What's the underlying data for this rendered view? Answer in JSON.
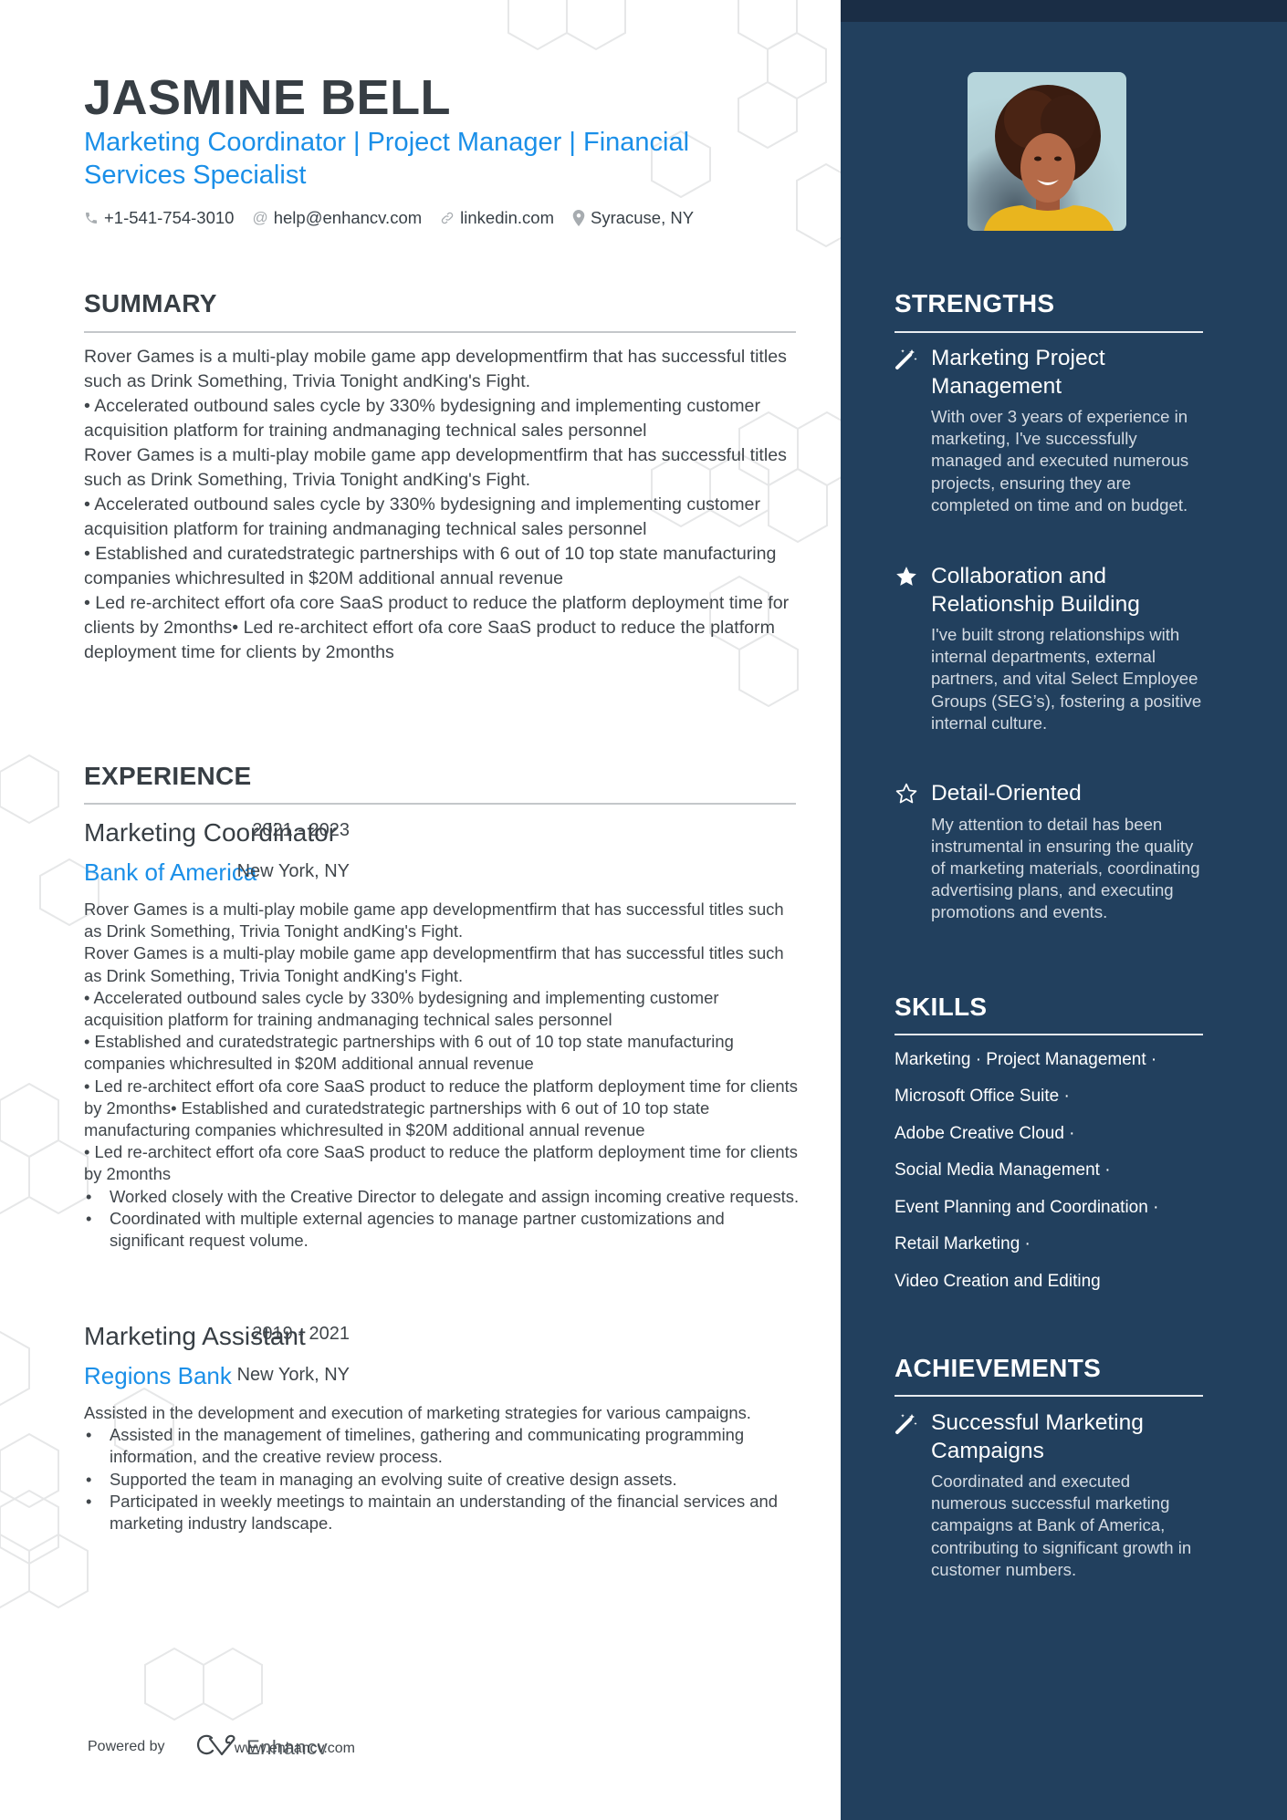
{
  "header": {
    "name": "JASMINE BELL",
    "subtitle": "Marketing Coordinator | Project Manager | Financial Services Specialist",
    "contacts": [
      {
        "icon": "phone-icon",
        "text": "+1-541-754-3010"
      },
      {
        "icon": "at-icon",
        "text": "help@enhancv.com"
      },
      {
        "icon": "link-icon",
        "text": "linkedin.com"
      },
      {
        "icon": "location-pin-icon",
        "text": "Syracuse, NY"
      }
    ]
  },
  "summary": {
    "title": "SUMMARY",
    "paragraphs": [
      "Rover Games is a multi-play mobile game app developmentfirm that has successful titles such as Drink Something, Trivia Tonight andKing's Fight.",
      "• Accelerated outbound sales cycle by 330% bydesigning and implementing customer acquisition platform for training andmanaging technical sales personnel",
      "Rover Games is a multi-play mobile game app developmentfirm that has successful titles such as Drink Something, Trivia Tonight andKing's Fight.",
      "• Accelerated outbound sales cycle by 330% bydesigning and implementing customer acquisition platform for training andmanaging technical sales personnel",
      "• Established and curatedstrategic partnerships with 6 out of 10 top state manufacturing companies whichresulted in $20M additional annual revenue",
      "• Led re-architect effort ofa core SaaS product to reduce the platform deployment time for clients by 2months• Led re-architect effort ofa core SaaS product to reduce the platform deployment time for clients by 2months"
    ]
  },
  "experience": {
    "title": "EXPERIENCE",
    "jobs": [
      {
        "title": "Marketing Coordinator",
        "dates": "2021 - 2023",
        "company": "Bank of America",
        "location": "New York, NY",
        "paragraphs": [
          "Rover Games is a multi-play mobile game app developmentfirm that has successful titles such as Drink Something, Trivia Tonight andKing's Fight.",
          "Rover Games is a multi-play mobile game app developmentfirm that has successful titles such as Drink Something, Trivia Tonight andKing's Fight.",
          "• Accelerated outbound sales cycle by 330% bydesigning and implementing customer acquisition platform for training andmanaging technical sales personnel",
          "• Established and curatedstrategic partnerships with 6 out of 10 top state manufacturing companies whichresulted in $20M additional annual revenue",
          "• Led re-architect effort ofa core SaaS product to reduce the platform deployment time for clients by 2months• Established and curatedstrategic partnerships with 6 out of 10 top state manufacturing companies whichresulted in $20M additional annual revenue",
          "• Led re-architect effort ofa core SaaS product to reduce the platform deployment time for clients by 2months"
        ],
        "bullets": [
          "Worked closely with the Creative Director to delegate and assign incoming creative requests.",
          "Coordinated with multiple external agencies to manage partner customizations and significant request volume."
        ]
      },
      {
        "title": "Marketing Assistant",
        "dates": "2019 - 2021",
        "company": "Regions Bank",
        "location": "New York, NY",
        "paragraphs": [
          "Assisted in the development and execution of marketing strategies for various campaigns."
        ],
        "bullets": [
          "Assisted in the management of timelines, gathering and communicating programming information, and the creative review process.",
          "Supported the team in managing an evolving suite of creative design assets.",
          "Participated in weekly meetings to maintain an understanding of the financial services and marketing industry landscape."
        ]
      }
    ]
  },
  "footer": {
    "powered_by": "Powered by",
    "brand": "Enhancv",
    "url": "www.enhancv.com"
  },
  "sidebar": {
    "photo_alt": "Profile photo of Jasmine Bell",
    "strengths": {
      "title": "STRENGTHS",
      "items": [
        {
          "icon": "magic-wand-icon",
          "title": "Marketing Project Management",
          "desc": "With over 3 years of experience in marketing, I've successfully managed and executed numerous projects, ensuring they are completed on time and on budget."
        },
        {
          "icon": "star-filled-icon",
          "title": "Collaboration and Relationship Building",
          "desc": "I've built strong relationships with internal departments, external partners, and vital Select Employee Groups (SEG’s), fostering a positive internal culture."
        },
        {
          "icon": "star-outline-icon",
          "title": "Detail-Oriented",
          "desc": "My attention to detail has been instrumental in ensuring the quality of marketing materials, coordinating advertising plans, and executing promotions and events."
        }
      ]
    },
    "skills": {
      "title": "SKILLS",
      "rows": [
        "Marketing · Project Management ·",
        "Microsoft Office Suite ·",
        "Adobe Creative Cloud ·",
        "Social Media Management ·",
        "Event Planning and Coordination ·",
        "Retail Marketing ·",
        "Video Creation and Editing"
      ]
    },
    "achievements": {
      "title": "ACHIEVEMENTS",
      "items": [
        {
          "icon": "magic-wand-icon",
          "title": "Successful Marketing Campaigns",
          "desc": "Coordinated and executed numerous successful marketing campaigns at Bank of America, contributing to significant growth in customer numbers."
        }
      ]
    }
  },
  "colors": {
    "sidebar_bg": "#22405e",
    "sidebar_top_band": "#1a2d45",
    "accent_blue": "#1a8fe8",
    "heading_text": "#373e44"
  }
}
